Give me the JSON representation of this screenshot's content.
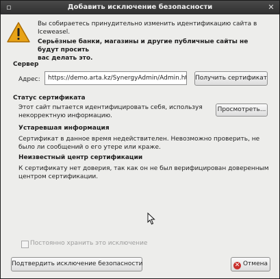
{
  "window": {
    "title": "Добавить исключение безопасности"
  },
  "message": {
    "line1": "Вы собираетесь принудительно изменить идентификацию сайта в",
    "line2": "Iceweasel.",
    "bold1": "Серьёзные банки, магазины и другие публичные сайты не будут просить",
    "bold2": "вас делать это."
  },
  "server": {
    "heading": "Сервер",
    "address_label": "Адрес:",
    "address_value": "https://demo.arta.kz/SynergyAdmin/Admin.htm",
    "get_cert_button": "Получить сертификат"
  },
  "status": {
    "heading": "Статус сертификата",
    "intro1": "Этот сайт пытается идентифицировать себя, используя",
    "intro2": "некорректную информацию.",
    "view_button": "Просмотреть...",
    "outdated_heading": "Устаревшая информация",
    "outdated1": "Сертификат в данное время недействителен. Невозможно проверить, не",
    "outdated2": "было ли сообщений о его утере или краже.",
    "unknown_ca_heading": "Неизвестный центр сертификации",
    "unknown_ca1": "К сертификату нет доверия, так как он не был верифицирован доверенным",
    "unknown_ca2": "центром сертификации."
  },
  "permanent_checkbox": {
    "label": "Постоянно хранить это исключение",
    "checked": false,
    "enabled": false
  },
  "footer": {
    "confirm_button": "Подтвердить исключение безопасности",
    "cancel_button": "Отмена"
  },
  "colors": {
    "warning": "#e8a317",
    "cancel_icon": "#c9302c"
  }
}
